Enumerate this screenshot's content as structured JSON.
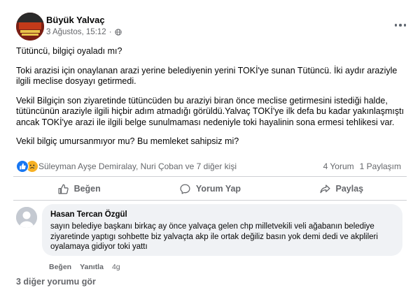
{
  "post": {
    "author": "Büyük Yalvaç",
    "timestamp": "3 Ağustos, 15:12",
    "separator": "·",
    "privacy_icon": "globe-icon",
    "paragraphs": [
      "Tütüncü, bilgiçi oyaladı mı?",
      "Toki arazisi için onaylanan arazi yerine belediyenin yerini TOKİ'ye sunan Tütüncü. İki aydır araziyle ilgili meclise dosyayı getirmedi.",
      "Vekil Bilgiçin son ziyaretinde tütüncüden bu araziyi biran önce meclise getirmesini istediği halde, tütüncünün araziyle ilgili hiçbir adım atmadığı görüldü.Yalvaç TOKİ'ye ilk defa bu kadar yakınlaşmıştı ancak TOKİ'ye arazi ile ilgili belge sunulmaması nedeniyle toki hayalinin sona ermesi tehlikesi var.",
      "Vekil bilgiç umursanmıyor mu? Bu memleket sahipsiz mi?"
    ]
  },
  "reactions": {
    "icons": [
      "like-icon",
      "sad-icon"
    ],
    "names": "Süleyman Ayşe Demiralay, Nuri Çoban ve 7 diğer kişi",
    "comments_count": "4 Yorum",
    "shares_count": "1 Paylaşım"
  },
  "actions": {
    "like": "Beğen",
    "comment": "Yorum Yap",
    "share": "Paylaş"
  },
  "comment": {
    "author": "Hasan Tercan Özgül",
    "text": "sayın belediye başkanı birkaç ay önce yalvaça gelen chp milletvekili veli ağabanın belediye ziyaretinde yaptıgı sohbette biz yalvaçta akp ile ortak değiliz basın yok demi dedi ve akplileri oyalamaya gidiyor toki yattı",
    "like_label": "Beğen",
    "reply_label": "Yanıtla",
    "age": "4g"
  },
  "more_comments": "3 diğer yorumu gör",
  "colors": {
    "accent": "#1877f2",
    "secondary_text": "#65676b",
    "comment_bg": "#f0f2f5"
  }
}
